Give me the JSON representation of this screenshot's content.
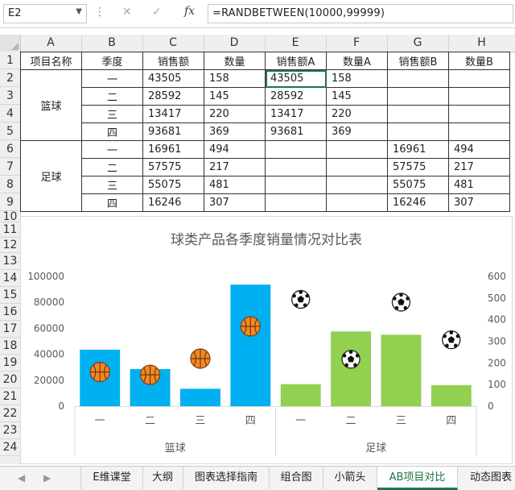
{
  "formula_bar": {
    "name_box": "E2",
    "fx_label": "fx",
    "cancel_glyph": "✕",
    "enter_glyph": "✓",
    "formula": "=RANDBETWEEN(10000,99999)"
  },
  "columns": [
    "A",
    "B",
    "C",
    "D",
    "E",
    "F",
    "G",
    "H"
  ],
  "rows": [
    "1",
    "2",
    "3",
    "4",
    "5",
    "6",
    "7",
    "8",
    "9",
    "10",
    "11",
    "12",
    "13",
    "14",
    "15",
    "16",
    "17",
    "18",
    "19",
    "20",
    "21",
    "22",
    "23",
    "24"
  ],
  "table": {
    "headers": [
      "项目名称",
      "季度",
      "销售额",
      "数量",
      "销售额A",
      "数量A",
      "销售额B",
      "数量B"
    ],
    "groups": [
      {
        "name": "篮球",
        "rows": [
          {
            "q": "一",
            "sales": "43505",
            "qty": "158",
            "salesA": "43505",
            "qtyA": "158",
            "salesB": "",
            "qtyB": ""
          },
          {
            "q": "二",
            "sales": "28592",
            "qty": "145",
            "salesA": "28592",
            "qtyA": "145",
            "salesB": "",
            "qtyB": ""
          },
          {
            "q": "三",
            "sales": "13417",
            "qty": "220",
            "salesA": "13417",
            "qtyA": "220",
            "salesB": "",
            "qtyB": ""
          },
          {
            "q": "四",
            "sales": "93681",
            "qty": "369",
            "salesA": "93681",
            "qtyA": "369",
            "salesB": "",
            "qtyB": ""
          }
        ]
      },
      {
        "name": "足球",
        "rows": [
          {
            "q": "一",
            "sales": "16961",
            "qty": "494",
            "salesA": "",
            "qtyA": "",
            "salesB": "16961",
            "qtyB": "494"
          },
          {
            "q": "二",
            "sales": "57575",
            "qty": "217",
            "salesA": "",
            "qtyA": "",
            "salesB": "57575",
            "qtyB": "217"
          },
          {
            "q": "三",
            "sales": "55075",
            "qty": "481",
            "salesA": "",
            "qtyA": "",
            "salesB": "55075",
            "qtyB": "481"
          },
          {
            "q": "四",
            "sales": "16246",
            "qty": "307",
            "salesA": "",
            "qtyA": "",
            "salesB": "16246",
            "qtyB": "307"
          }
        ]
      }
    ]
  },
  "chart_data": {
    "type": "bar",
    "title": "球类产品各季度销量情况对比表",
    "groups": [
      "篮球",
      "足球"
    ],
    "categories": [
      "一",
      "二",
      "三",
      "四"
    ],
    "series": [
      {
        "name": "销售额A",
        "axis": "left",
        "color": "#00b0f0",
        "values": [
          43505,
          28592,
          13417,
          93681
        ]
      },
      {
        "name": "销售额B",
        "axis": "left",
        "color": "#92d050",
        "values": [
          16961,
          57575,
          55075,
          16246
        ]
      },
      {
        "name": "数量A",
        "axis": "right",
        "marker": "basketball",
        "values": [
          158,
          145,
          220,
          369
        ]
      },
      {
        "name": "数量B",
        "axis": "right",
        "marker": "soccer-ball",
        "values": [
          494,
          217,
          481,
          307
        ]
      }
    ],
    "y_left": {
      "ticks": [
        "0",
        "20000",
        "40000",
        "60000",
        "80000",
        "100000"
      ],
      "min": 0,
      "max": 100000
    },
    "y_right": {
      "ticks": [
        "0",
        "100",
        "200",
        "300",
        "400",
        "500",
        "600"
      ],
      "min": 0,
      "max": 600
    },
    "grid": false,
    "legend": "none"
  },
  "tabs": {
    "items": [
      "E维课堂",
      "大纲",
      "图表选择指南",
      "组合图",
      "小箭头",
      "AB项目对比",
      "动态图表"
    ],
    "active": "AB项目对比"
  }
}
